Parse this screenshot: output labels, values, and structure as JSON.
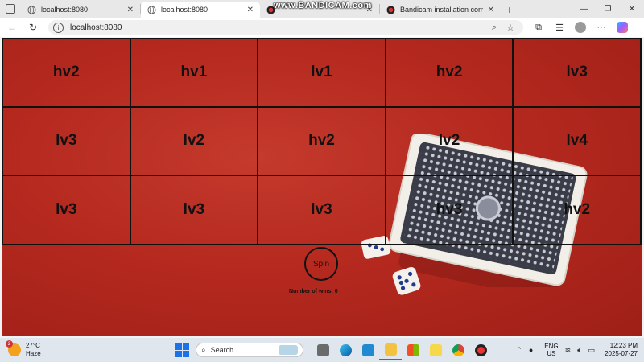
{
  "browser": {
    "tabs": [
      {
        "title": "localhost:8080",
        "active": false,
        "icon": "globe-icon"
      },
      {
        "title": "localhost:8080",
        "active": true,
        "icon": "globe-icon"
      },
      {
        "title": "",
        "active": false,
        "icon": "bandicam-icon"
      },
      {
        "title": "Bandicam installation completed",
        "active": false,
        "icon": "bandicam-icon"
      }
    ],
    "overlay_watermark": "www.BANDICAM.com",
    "address": "localhost:8080"
  },
  "game": {
    "grid": [
      [
        "hv2",
        "hv1",
        "lv1",
        "hv2",
        "lv3"
      ],
      [
        "lv3",
        "lv2",
        "hv2",
        "lv2",
        "lv4"
      ],
      [
        "lv3",
        "lv3",
        "lv3",
        "hv3",
        "hv2"
      ]
    ],
    "spin_label": "Spin",
    "wins_text": "Number of wins: 0"
  },
  "taskbar": {
    "weather_temp": "27°C",
    "weather_desc": "Haze",
    "weather_badge": "2",
    "search_placeholder": "Search",
    "lang_top": "ENG",
    "lang_bottom": "US",
    "time": "12:23 PM",
    "date": "2025-07-27"
  },
  "colors": {
    "background_red": "#b5291f",
    "grid_line": "#111111",
    "taskbar_bg": "#dfe6ee"
  }
}
